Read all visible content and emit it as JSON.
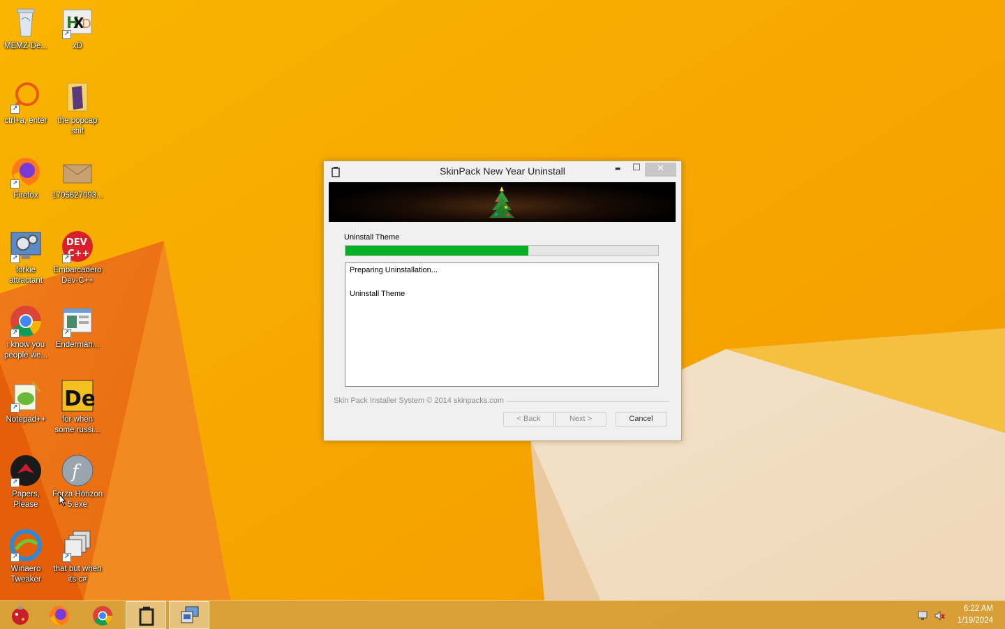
{
  "desktop": {
    "icons": [
      {
        "label": "MEMZ-De...",
        "icon": "recycle-bin-icon"
      },
      {
        "label": "xD",
        "icon": "hxd-icon"
      },
      {
        "label": "ctrl+a, enter",
        "icon": "magnifier-icon"
      },
      {
        "label": "the popcap shit",
        "icon": "folder-icon"
      },
      {
        "label": "Firefox",
        "icon": "firefox-icon"
      },
      {
        "label": "1705627093...",
        "icon": "image-file-icon"
      },
      {
        "label": "forkie attractant",
        "icon": "settings-monitor-icon"
      },
      {
        "label": "Embarcadero Dev-C++",
        "icon": "devcpp-icon"
      },
      {
        "label": "i know you people we...",
        "icon": "chrome-icon"
      },
      {
        "label": "Enderman...",
        "icon": "window-app-icon"
      },
      {
        "label": "Notepad++",
        "icon": "notepadpp-icon"
      },
      {
        "label": "for when some russi...",
        "icon": "de-icon"
      },
      {
        "label": "Papers, Please",
        "icon": "papers-please-icon"
      },
      {
        "label": "Forza Horizon 5.exe",
        "icon": "flash-icon"
      },
      {
        "label": "Winaero Tweaker",
        "icon": "winaero-icon"
      },
      {
        "label": "that but when its c#",
        "icon": "windows-stack-icon"
      }
    ]
  },
  "dialog": {
    "title": "SkinPack New Year Uninstall",
    "close_glyph": "✕",
    "min_glyph": "▬",
    "max_glyph": "☐",
    "section_label": "Uninstall Theme",
    "progress_fraction": 0.585,
    "log_lines": [
      "Preparing Uninstallation...",
      "",
      "Uninstall Theme"
    ],
    "footer_text": "Skin Pack Installer System © 2014 skinpacks.com",
    "buttons": {
      "back": "< Back",
      "next": "Next >",
      "cancel": "Cancel"
    }
  },
  "taskbar": {
    "apps": [
      "ornament-icon",
      "firefox-icon",
      "chrome-icon",
      "uninstaller-icon",
      "computer-icon"
    ],
    "time": "6:22 AM",
    "date": "1/19/2024"
  }
}
